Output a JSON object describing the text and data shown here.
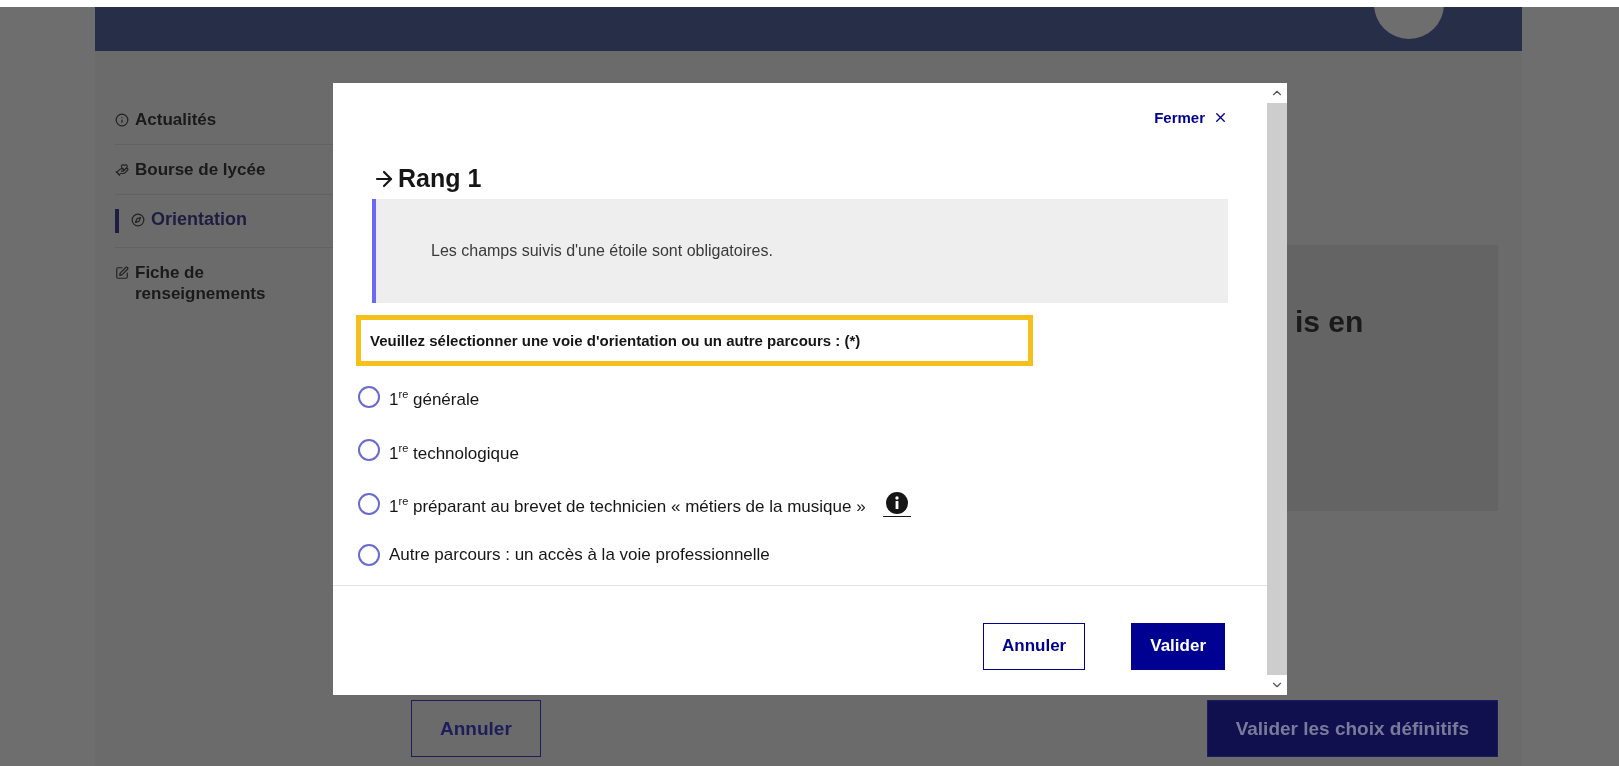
{
  "sidebar": {
    "items": [
      {
        "label": "Actualités",
        "selected": false
      },
      {
        "label": "Bourse de lycée",
        "selected": false
      },
      {
        "label": "Orientation",
        "selected": true
      },
      {
        "label": "Fiche de renseignements",
        "selected": false
      }
    ]
  },
  "background_card": {
    "text": "is en"
  },
  "page_buttons": [
    {
      "label": "Annuler",
      "kind": "secondary"
    },
    {
      "label": "Valider les choix définitifs",
      "kind": "primary"
    }
  ],
  "modal": {
    "close_label": "Fermer",
    "title": "Rang 1",
    "notice": "Les champs suivis d'une étoile sont obligatoires.",
    "question": "Veuillez sélectionner une voie d'orientation ou un autre parcours : (*)",
    "options": [
      {
        "label": "1$^{re}$ générale",
        "selected": false,
        "has_info": false
      },
      {
        "label": "1$^{re}$ technologique",
        "selected": false,
        "has_info": false
      },
      {
        "label": "1$^{re}$ préparant au brevet de technicien « métiers de la musique »",
        "selected": false,
        "has_info": true
      },
      {
        "label": "Autre parcours : un accès à la voie professionnelle",
        "selected": false,
        "has_info": false
      }
    ],
    "buttons": [
      {
        "label": "Annuler",
        "kind": "secondary"
      },
      {
        "label": "Valider",
        "kind": "primary"
      }
    ]
  }
}
